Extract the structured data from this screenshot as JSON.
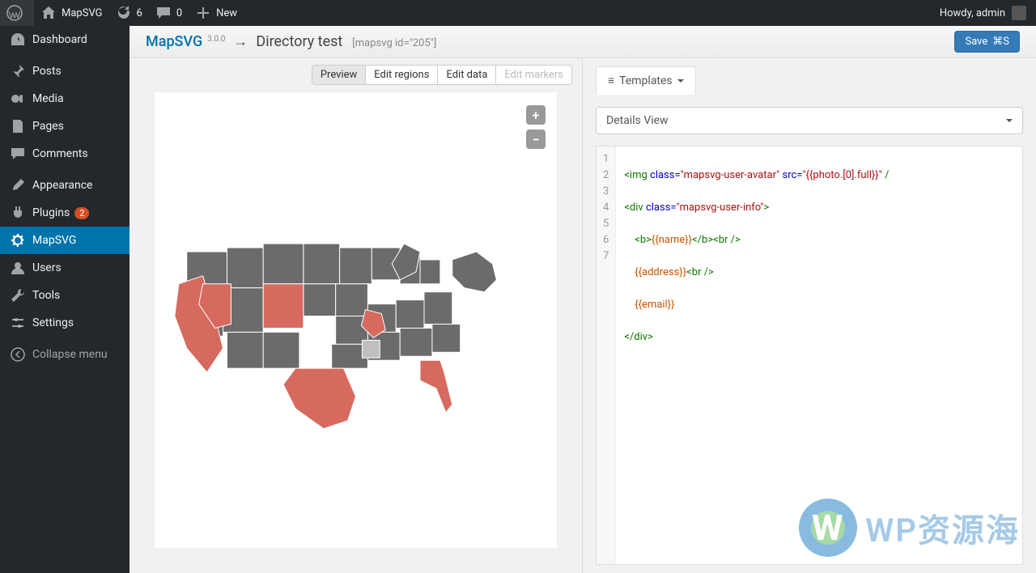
{
  "adminBar": {
    "siteName": "MapSVG",
    "updates": "6",
    "comments": "0",
    "newLabel": "New",
    "howdy": "Howdy, admin"
  },
  "sidebar": {
    "items": [
      {
        "name": "dashboard",
        "label": "Dashboard"
      },
      {
        "name": "posts",
        "label": "Posts"
      },
      {
        "name": "media",
        "label": "Media"
      },
      {
        "name": "pages",
        "label": "Pages"
      },
      {
        "name": "comments",
        "label": "Comments"
      },
      {
        "name": "appearance",
        "label": "Appearance"
      },
      {
        "name": "plugins",
        "label": "Plugins",
        "badge": "2"
      },
      {
        "name": "mapsvg",
        "label": "MapSVG",
        "current": true
      },
      {
        "name": "users",
        "label": "Users"
      },
      {
        "name": "tools",
        "label": "Tools"
      },
      {
        "name": "settings",
        "label": "Settings"
      }
    ],
    "collapse": "Collapse menu"
  },
  "header": {
    "pluginLink": "MapSVG",
    "version": "3.0.0",
    "arrow": "→",
    "title": "Directory test",
    "shortcode": "[mapsvg id=\"205\"]",
    "saveLabel": "Save",
    "saveHint": "⌘S"
  },
  "leftTabs": {
    "preview": "Preview",
    "editRegions": "Edit regions",
    "editData": "Edit data",
    "editMarkers": "Edit markers"
  },
  "zoom": {
    "plus": "+",
    "minus": "−"
  },
  "rightPane": {
    "tabLabel": "Templates",
    "dropdown": "Details View"
  },
  "code": {
    "lines": [
      "1",
      "2",
      "3",
      "4",
      "5",
      "6",
      "7"
    ],
    "l1": {
      "a": "<img",
      "b": " class=",
      "c": "\"mapsvg-user-avatar\"",
      "d": " src=",
      "e": "\"{{photo.[0].full}}\"",
      "f": " /"
    },
    "l2": {
      "a": "<div",
      "b": " class=",
      "c": "\"mapsvg-user-info\"",
      "d": ">"
    },
    "l3": {
      "a": "    <b>",
      "b": "{{name}}",
      "c": "</b><br />"
    },
    "l4": {
      "a": "    ",
      "b": "{{address}}",
      "c": "<br />"
    },
    "l5": {
      "a": "    ",
      "b": "{{email}}"
    },
    "l6": {
      "a": "</div>"
    }
  },
  "watermark": "WP资源海",
  "colors": {
    "mapDefault": "#6b6b6b",
    "mapHighlight": "#d66a5e",
    "mapLight": "#bfbfbf"
  }
}
